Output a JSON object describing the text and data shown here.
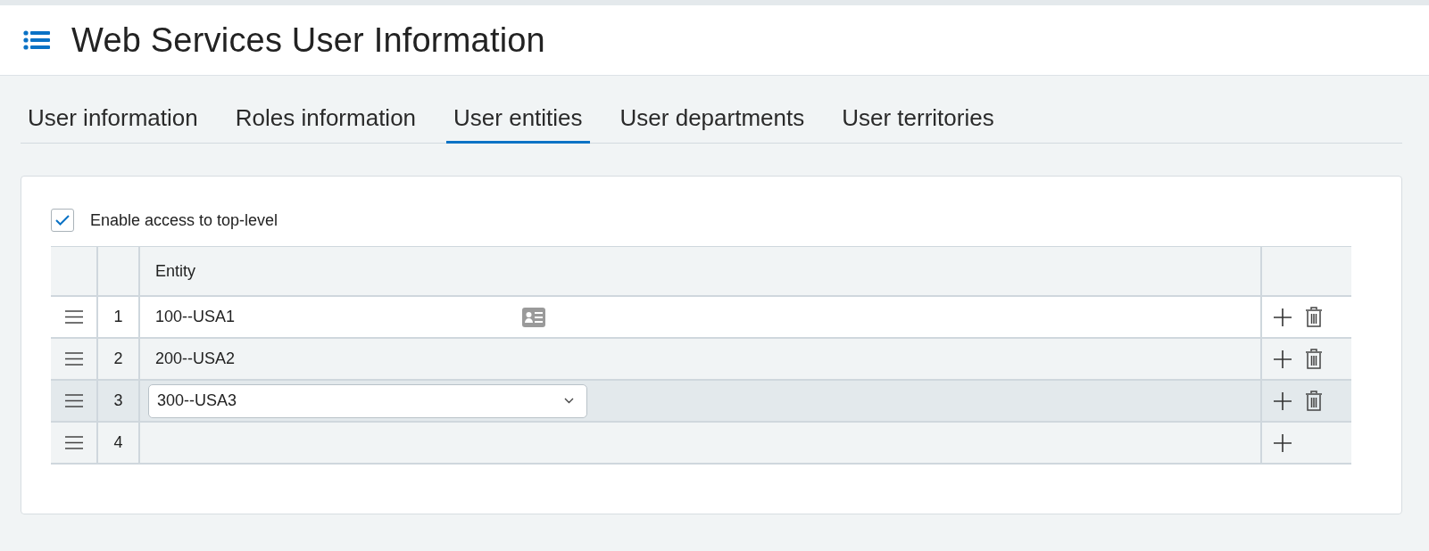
{
  "page": {
    "title": "Web Services User Information"
  },
  "tabs": [
    {
      "label": "User information",
      "selected": false
    },
    {
      "label": "Roles information",
      "selected": false
    },
    {
      "label": "User entities",
      "selected": true
    },
    {
      "label": "User departments",
      "selected": false
    },
    {
      "label": "User territories",
      "selected": false
    }
  ],
  "top_level_access": {
    "label": "Enable access to top-level",
    "checked": true
  },
  "table": {
    "columns": [
      "Entity"
    ],
    "rows": [
      {
        "number": "1",
        "kind": "text",
        "entity": "100--USA1",
        "lookup_icon": true,
        "selected": false,
        "deletable": true
      },
      {
        "number": "2",
        "kind": "text",
        "entity": "200--USA2",
        "selected": false,
        "deletable": true
      },
      {
        "number": "3",
        "kind": "select",
        "entity": "300--USA3",
        "selected": true,
        "deletable": true
      },
      {
        "number": "4",
        "kind": "empty",
        "selected": false,
        "deletable": false
      }
    ]
  }
}
